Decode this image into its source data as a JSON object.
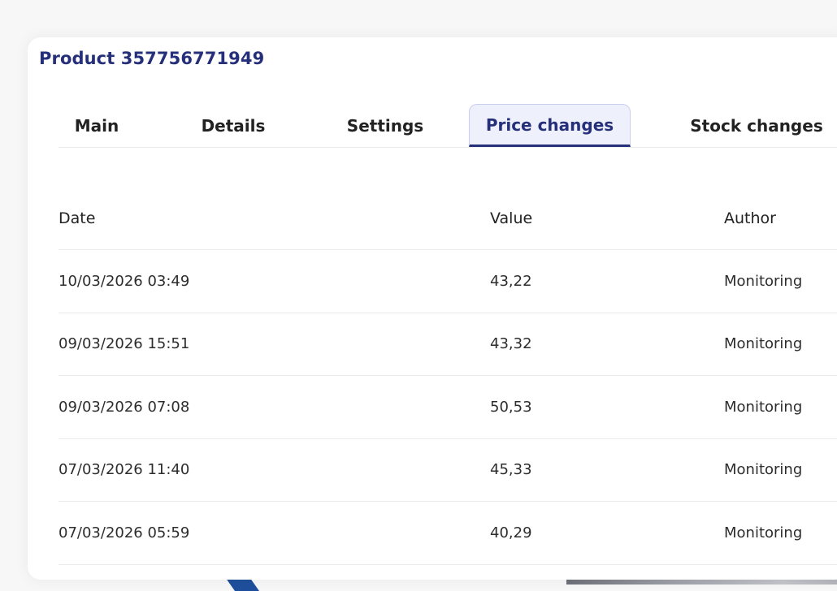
{
  "product": {
    "title": "Product 357756771949"
  },
  "tabs": [
    {
      "label": "Main",
      "active": false
    },
    {
      "label": "Details",
      "active": false
    },
    {
      "label": "Settings",
      "active": false
    },
    {
      "label": "Price changes",
      "active": true
    },
    {
      "label": "Stock changes",
      "active": false
    }
  ],
  "table": {
    "columns": [
      "Date",
      "Value",
      "Author"
    ],
    "rows": [
      {
        "date": "10/03/2026 03:49",
        "value": "43,22",
        "author": "Monitoring"
      },
      {
        "date": "09/03/2026 15:51",
        "value": "43,32",
        "author": "Monitoring"
      },
      {
        "date": "09/03/2026 07:08",
        "value": "50,53",
        "author": "Monitoring"
      },
      {
        "date": "07/03/2026 11:40",
        "value": "45,33",
        "author": "Monitoring"
      },
      {
        "date": "07/03/2026 05:59",
        "value": "40,29",
        "author": "Monitoring"
      }
    ]
  },
  "colors": {
    "accent": "#26307a",
    "active_tab_bg": "#eef0fb",
    "divider": "#ececef"
  }
}
